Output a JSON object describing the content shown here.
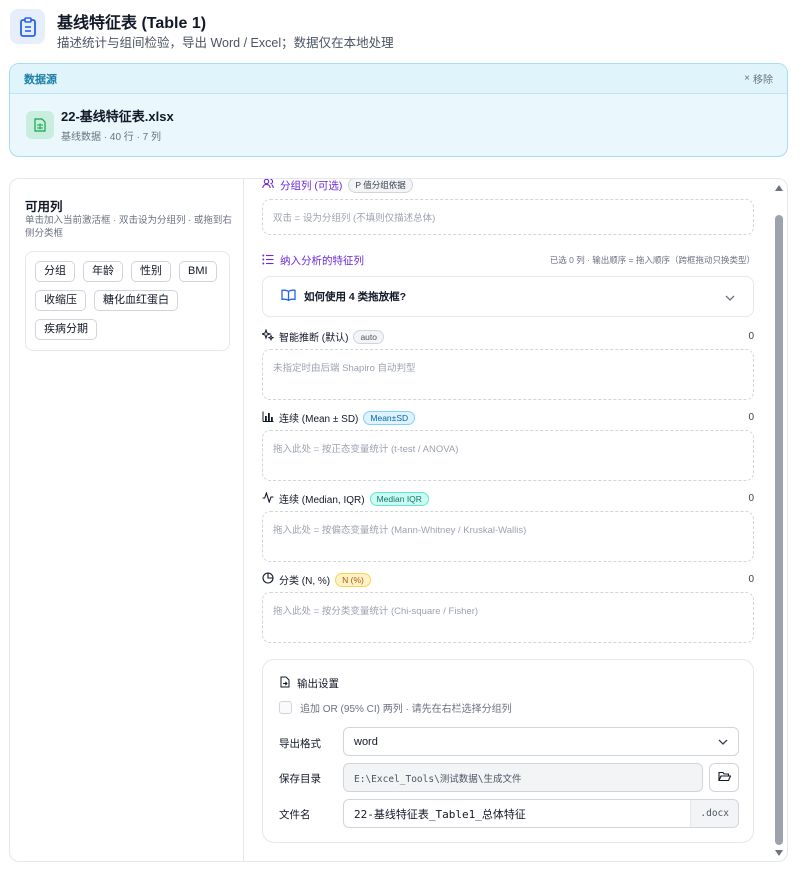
{
  "header": {
    "title": "基线特征表 (Table 1)",
    "subtitle": "描述统计与组间检验，导出 Word / Excel；数据仅在本地处理",
    "icon": "clipboard-icon"
  },
  "source": {
    "label": "数据源",
    "remove_label": "移除",
    "file_name": "22-基线特征表.xlsx",
    "file_meta": "基线数据 · 40 行 · 7 列"
  },
  "columns": {
    "title": "可用列",
    "hint": "单击加入当前激活框 · 双击设为分组列 · 或拖到右侧分类框",
    "items": [
      "分组",
      "年龄",
      "性别",
      "BMI",
      "收缩压",
      "糖化血红蛋白",
      "疾病分期"
    ]
  },
  "group": {
    "title": "分组列 (可选)",
    "badge": "P 值分组依据",
    "placeholder": "双击 = 设为分组列 (不填则仅描述总体)"
  },
  "features": {
    "title": "纳入分析的特征列",
    "note": "已选 0 列 · 输出顺序 = 拖入顺序（跨框拖动只换类型）",
    "howto": "如何使用 4 类拖放框?"
  },
  "categories": [
    {
      "name": "智能推断 (默认)",
      "tag": "auto",
      "count": "0",
      "placeholder": "未指定时由后端 Shapiro 自动判型"
    },
    {
      "name": "连续 (Mean ± SD)",
      "tag": "Mean±SD",
      "count": "0",
      "placeholder": "拖入此处 = 按正态变量统计 (t-test / ANOVA)"
    },
    {
      "name": "连续 (Median, IQR)",
      "tag": "Median IQR",
      "count": "0",
      "placeholder": "拖入此处 = 按偏态变量统计 (Mann-Whitney / Kruskal-Wallis)"
    },
    {
      "name": "分类 (N, %)",
      "tag": "N (%)",
      "count": "0",
      "placeholder": "拖入此处 = 按分类变量统计 (Chi-square / Fisher)"
    }
  ],
  "output": {
    "title": "输出设置",
    "or_label": "追加 OR (95% CI) 两列 · 请先在右栏选择分组列",
    "format_label": "导出格式",
    "format_value": "word",
    "dir_label": "保存目录",
    "dir_value": "E:\\Excel_Tools\\测试数据\\生成文件",
    "name_label": "文件名",
    "name_value": "22-基线特征表_Table1_总体特征",
    "ext": ".docx"
  }
}
